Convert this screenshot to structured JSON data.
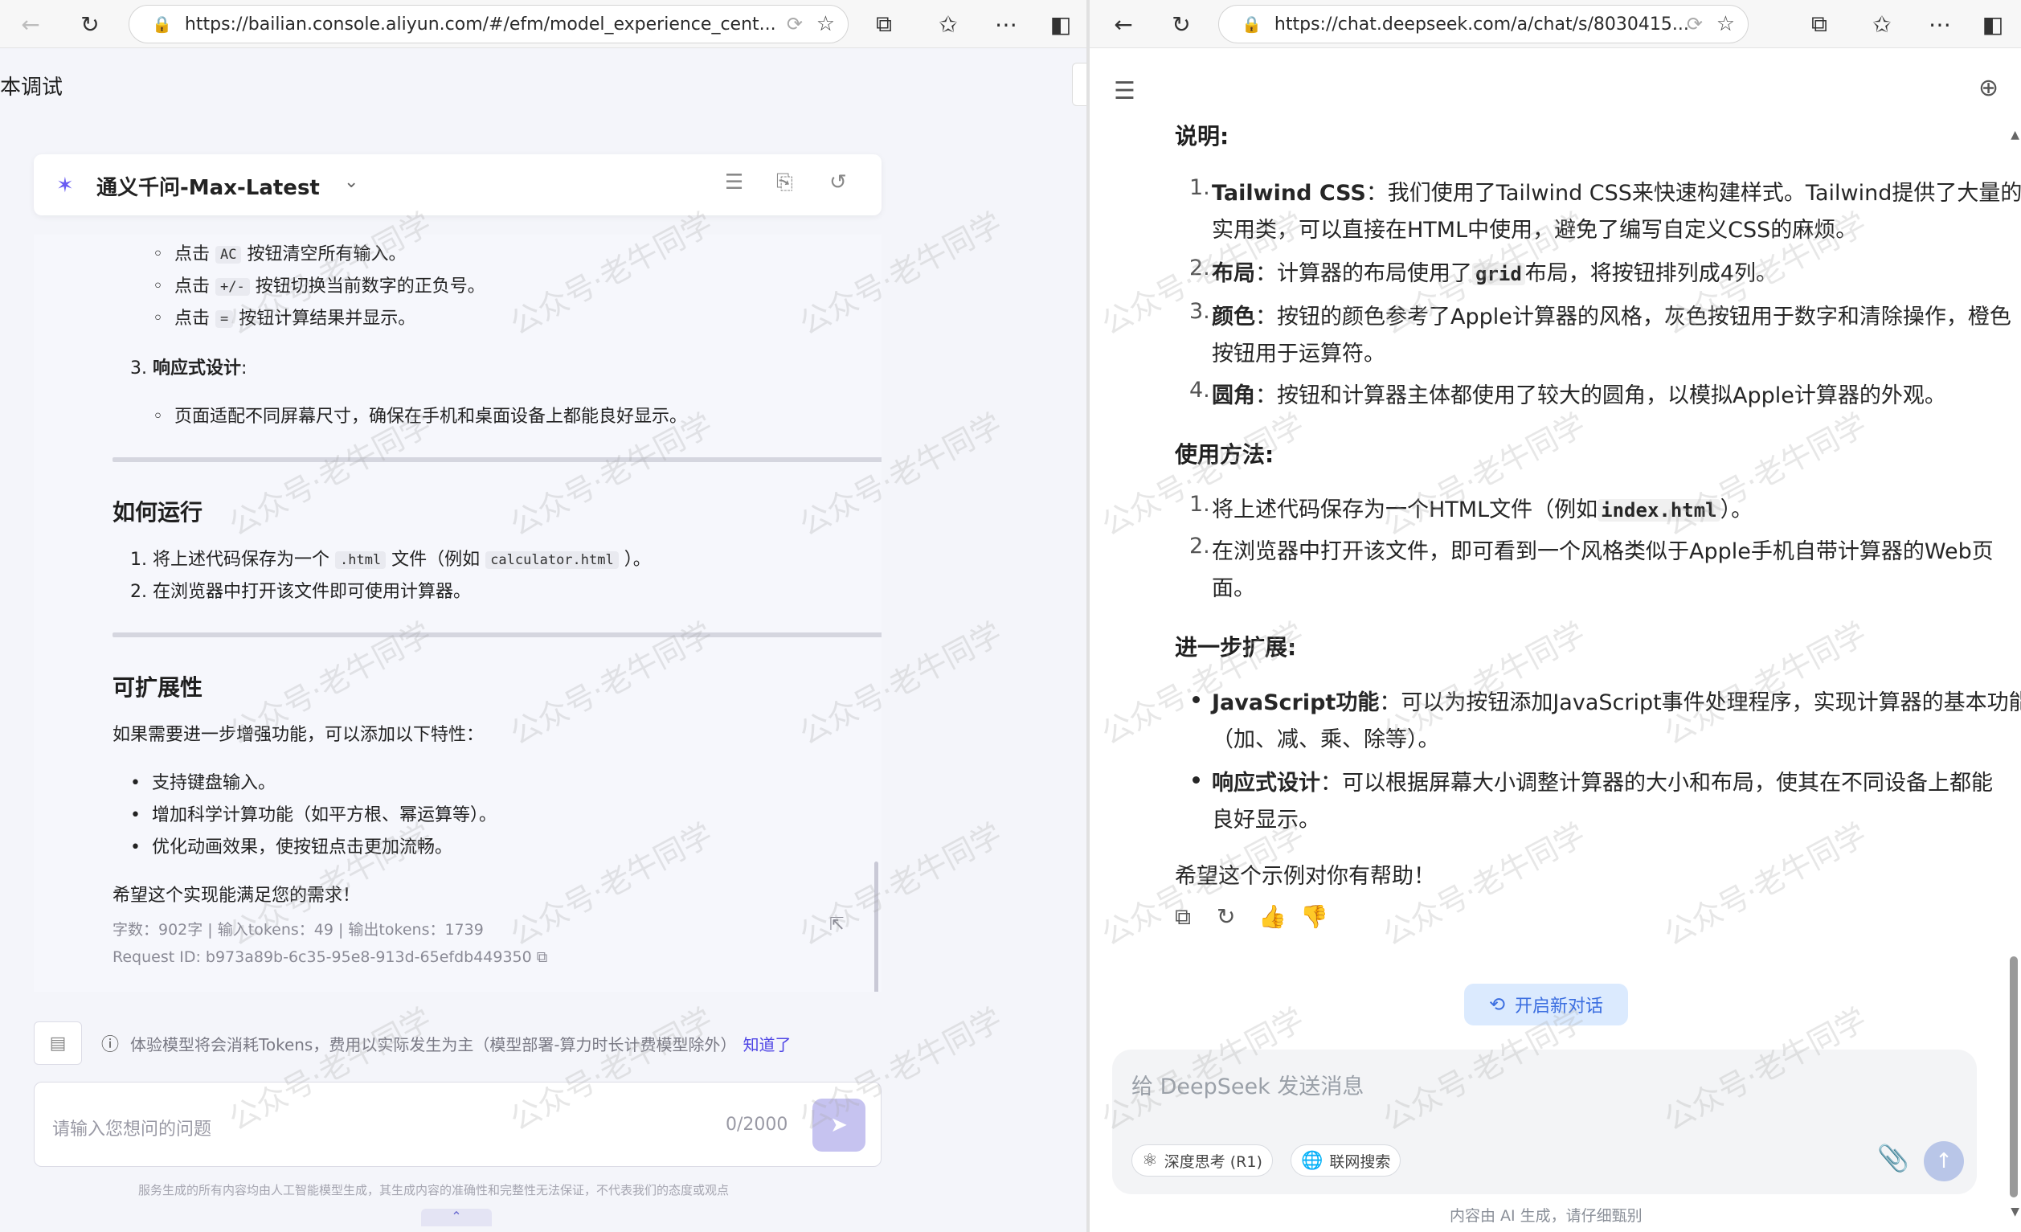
{
  "left_browser": {
    "url": "https://bailian.console.aliyun.com/#/efm/model_experience_cent..."
  },
  "left_page": {
    "title": "本调试",
    "model_name": "通义千问-Max-Latest",
    "list_items_top": [
      {
        "pre": "点击",
        "code": "AC",
        "post": "按钮清空所有输入。"
      },
      {
        "pre": "点击",
        "code": "+/-",
        "post": "按钮切换当前数字的正负号。"
      },
      {
        "pre": "点击",
        "code": "=",
        "post": "按钮计算结果并显示。"
      }
    ],
    "responsive_num": "3.",
    "responsive_label": "响应式设计",
    "responsive_colon": ":",
    "responsive_item": "页面适配不同屏幕尺寸，确保在手机和桌面设备上都能良好显示。",
    "how_to_run_heading": "如何运行",
    "run_step1_pre": "1. 将上述代码保存为一个",
    "run_step1_code1": ".html",
    "run_step1_mid": "文件（例如",
    "run_step1_code2": "calculator.html",
    "run_step1_post": "）。",
    "run_step2": "2. 在浏览器中打开该文件即可使用计算器。",
    "extensibility_heading": "可扩展性",
    "extensibility_intro": "如果需要进一步增强功能，可以添加以下特性：",
    "extensibility_items": [
      "支持键盘输入。",
      "增加科学计算功能（如平方根、幂运算等）。",
      "优化动画效果，使按钮点击更加流畅。"
    ],
    "closing": "希望这个实现能满足您的需求！",
    "stats": "字数：902字 | 输入tokens：49 | 输出tokens：1739",
    "request_id": "Request ID: b973a89b-6c35-95e8-913d-65efdb449350",
    "notice_text": "体验模型将会消耗Tokens，费用以实际发生为主（模型部署-算力时长计费模型除外）",
    "notice_link": "知道了",
    "input_placeholder": "请输入您想问的问题",
    "input_counter": "0/2000",
    "disclaimer": "服务生成的所有内容均由人工智能模型生成，其生成内容的准确性和完整性无法保证，不代表我们的态度或观点"
  },
  "right_browser": {
    "url": "https://chat.deepseek.com/a/chat/s/8030415..."
  },
  "right_page": {
    "section1_heading": "说明:",
    "section1_items": [
      {
        "num": "1.",
        "bold": "Tailwind CSS",
        "line1": "：我们使用了Tailwind CSS来快速构建样式。Tailwind提供了大量的",
        "line2": "实用类，可以直接在HTML中使用，避免了编写自定义CSS的麻烦。"
      },
      {
        "num": "2.",
        "bold": "布局",
        "pre": "：计算器的布局使用了",
        "code": "grid",
        "post": "布局，将按钮排列成4列。"
      },
      {
        "num": "3.",
        "bold": "颜色",
        "line1": "：按钮的颜色参考了Apple计算器的风格，灰色按钮用于数字和清除操作，橙色",
        "line2": "按钮用于运算符。"
      },
      {
        "num": "4.",
        "bold": "圆角",
        "line1": "：按钮和计算器主体都使用了较大的圆角，以模拟Apple计算器的外观。"
      }
    ],
    "section2_heading": "使用方法:",
    "section2_items": [
      {
        "num": "1.",
        "pre": "将上述代码保存为一个HTML文件（例如",
        "code": "index.html",
        "post": "）。"
      },
      {
        "num": "2.",
        "line1": "在浏览器中打开该文件，即可看到一个风格类似于Apple手机自带计算器的Web页",
        "line2": "面。"
      }
    ],
    "section3_heading": "进一步扩展:",
    "section3_items": [
      {
        "bold": "JavaScript功能",
        "line1": "：可以为按钮添加JavaScript事件处理程序，实现计算器的基本功能",
        "line2": "（加、减、乘、除等）。"
      },
      {
        "bold": "响应式设计",
        "line1": "：可以根据屏幕大小调整计算器的大小和布局，使其在不同设备上都能",
        "line2": "良好显示。"
      }
    ],
    "closing": "希望这个示例对你有帮助！",
    "new_chat_label": "开启新对话",
    "input_placeholder": "给 DeepSeek 发送消息",
    "deep_think_label": "深度思考 (R1)",
    "web_search_label": "联网搜索",
    "footer": "内容由 AI 生成，请仔细甄别"
  },
  "watermark_text": "公众号·老牛同学",
  "icons": {
    "back": "back-arrow-icon",
    "refresh": "refresh-icon",
    "lock": "lock-icon",
    "favorite": "star-icon",
    "extensions": "puzzle-icon",
    "favorites": "favorites-icon",
    "more": "more-icon",
    "split": "split-screen-icon"
  },
  "colors": {
    "accent_purple": "#4f46e5",
    "deepseek_blue": "#3b6ee0"
  }
}
